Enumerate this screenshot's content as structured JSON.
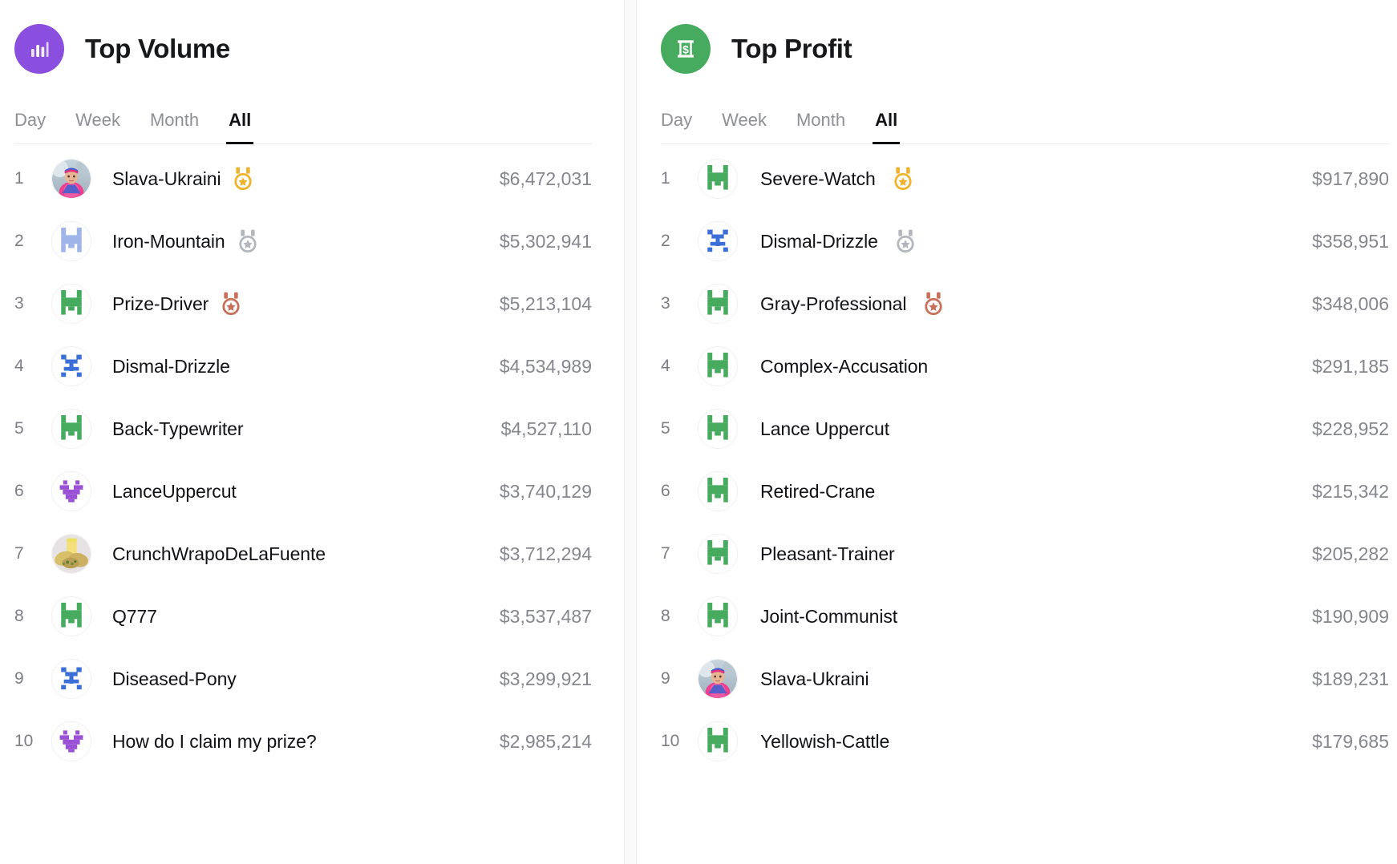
{
  "panels": [
    {
      "id": "top-volume",
      "icon_name": "bar-chart-icon",
      "icon_color": "#8b4fe0",
      "title": "Top Volume",
      "tabs": [
        {
          "label": "Day",
          "active": false
        },
        {
          "label": "Week",
          "active": false
        },
        {
          "label": "Month",
          "active": false
        },
        {
          "label": "All",
          "active": true
        }
      ],
      "rows": [
        {
          "rank": "1",
          "name": "Slava-Ukraini",
          "amount": "$6,472,031",
          "avatar": "photo-athlete",
          "avatar_color": "#e8479a",
          "medal": "gold"
        },
        {
          "rank": "2",
          "name": "Iron-Mountain",
          "amount": "$5,302,941",
          "avatar": "pixel-robot",
          "avatar_color": "#9fb4e8",
          "medal": "silver"
        },
        {
          "rank": "3",
          "name": "Prize-Driver",
          "amount": "$5,213,104",
          "avatar": "pixel-robot",
          "avatar_color": "#46ab5e",
          "medal": "bronze"
        },
        {
          "rank": "4",
          "name": "Dismal-Drizzle",
          "amount": "$4,534,989",
          "avatar": "pixel-robot-b",
          "avatar_color": "#3a6fd8",
          "medal": "none"
        },
        {
          "rank": "5",
          "name": "Back-Typewriter",
          "amount": "$4,527,110",
          "avatar": "pixel-robot",
          "avatar_color": "#46ab5e",
          "medal": "none"
        },
        {
          "rank": "6",
          "name": "LanceUppercut",
          "amount": "$3,740,129",
          "avatar": "pixel-robot-c",
          "avatar_color": "#9b51d6",
          "medal": "none"
        },
        {
          "rank": "7",
          "name": "CrunchWrapoDeLaFuente",
          "amount": "$3,712,294",
          "avatar": "photo-food",
          "avatar_color": "#d6c27a",
          "medal": "none"
        },
        {
          "rank": "8",
          "name": "Q777",
          "amount": "$3,537,487",
          "avatar": "pixel-robot",
          "avatar_color": "#46ab5e",
          "medal": "none"
        },
        {
          "rank": "9",
          "name": "Diseased-Pony",
          "amount": "$3,299,921",
          "avatar": "pixel-robot-b",
          "avatar_color": "#3a6fd8",
          "medal": "none"
        },
        {
          "rank": "10",
          "name": "How do I claim my prize?",
          "amount": "$2,985,214",
          "avatar": "pixel-robot-c",
          "avatar_color": "#9b51d6",
          "medal": "none"
        }
      ]
    },
    {
      "id": "top-profit",
      "icon_name": "money-bill-icon",
      "icon_color": "#46ab5e",
      "title": "Top Profit",
      "tabs": [
        {
          "label": "Day",
          "active": false
        },
        {
          "label": "Week",
          "active": false
        },
        {
          "label": "Month",
          "active": false
        },
        {
          "label": "All",
          "active": true
        }
      ],
      "rows": [
        {
          "rank": "1",
          "name": "Severe-Watch",
          "amount": "$917,890",
          "avatar": "pixel-robot",
          "avatar_color": "#46ab5e",
          "medal": "gold"
        },
        {
          "rank": "2",
          "name": "Dismal-Drizzle",
          "amount": "$358,951",
          "avatar": "pixel-robot-b",
          "avatar_color": "#3a6fd8",
          "medal": "silver"
        },
        {
          "rank": "3",
          "name": "Gray-Professional",
          "amount": "$348,006",
          "avatar": "pixel-robot",
          "avatar_color": "#46ab5e",
          "medal": "bronze"
        },
        {
          "rank": "4",
          "name": "Complex-Accusation",
          "amount": "$291,185",
          "avatar": "pixel-robot",
          "avatar_color": "#46ab5e",
          "medal": "none"
        },
        {
          "rank": "5",
          "name": "Lance Uppercut",
          "amount": "$228,952",
          "avatar": "pixel-robot",
          "avatar_color": "#46ab5e",
          "medal": "none"
        },
        {
          "rank": "6",
          "name": "Retired-Crane",
          "amount": "$215,342",
          "avatar": "pixel-robot",
          "avatar_color": "#46ab5e",
          "medal": "none"
        },
        {
          "rank": "7",
          "name": "Pleasant-Trainer",
          "amount": "$205,282",
          "avatar": "pixel-robot",
          "avatar_color": "#46ab5e",
          "medal": "none"
        },
        {
          "rank": "8",
          "name": "Joint-Communist",
          "amount": "$190,909",
          "avatar": "pixel-robot",
          "avatar_color": "#46ab5e",
          "medal": "none"
        },
        {
          "rank": "9",
          "name": "Slava-Ukraini",
          "amount": "$189,231",
          "avatar": "photo-athlete",
          "avatar_color": "#e8479a",
          "medal": "none"
        },
        {
          "rank": "10",
          "name": "Yellowish-Cattle",
          "amount": "$179,685",
          "avatar": "pixel-robot",
          "avatar_color": "#46ab5e",
          "medal": "none"
        }
      ]
    }
  ],
  "medal_colors": {
    "gold": "#efb32e",
    "silver": "#b3b7bd",
    "bronze": "#c9705a"
  }
}
